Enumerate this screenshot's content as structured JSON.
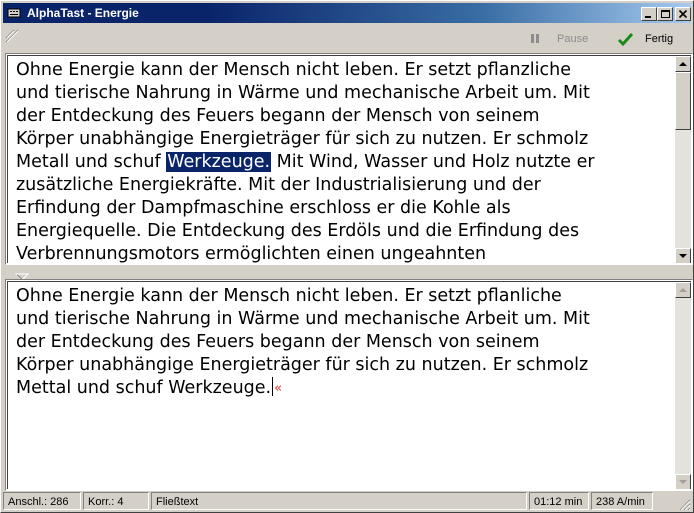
{
  "window": {
    "title": "AlphaTast - Energie"
  },
  "toolbar": {
    "pause_label": "Pause",
    "done_label": "Fertig"
  },
  "reference_text": {
    "lines": [
      {
        "parts": [
          "Ohne Energie kann der Mensch nicht leben. Er setzt pflanzliche"
        ]
      },
      {
        "parts": [
          "und tierische Nahrung in Wärme und mechanische Arbeit um. Mit"
        ]
      },
      {
        "parts": [
          "der Entdeckung des Feuers begann der Mensch von seinem"
        ]
      },
      {
        "parts": [
          "Körper unabhängige Energieträger für sich zu nutzen. Er schmolz"
        ]
      },
      {
        "parts": [
          "Metall und schuf ",
          "Werkzeuge.",
          " Mit Wind, Wasser und Holz nutzte er"
        ]
      },
      {
        "parts": [
          "zusätzliche Energiekräfte. Mit der Industrialisierung und der"
        ]
      },
      {
        "parts": [
          "Erfindung der Dampfmaschine erschloss er die Kohle als"
        ]
      },
      {
        "parts": [
          "Energiequelle. Die Entdeckung des Erdöls und die Erfindung des"
        ]
      },
      {
        "parts": [
          "Verbrennungsmotors ermöglichten einen ungeahnten"
        ]
      }
    ]
  },
  "typed_text": {
    "lines": [
      "Ohne Energie kann der Mensch nicht leben. Er setzt pflanliche",
      "und tierische Nahrung in Wärme und mechanische Arbeit um. Mit",
      "der Entdeckung des Feuers begann der Mensch von seinem",
      "Körper unabhängige Energieträger für sich zu nutzen. Er schmolz",
      "Mettal und schuf Werkzeuge."
    ],
    "error_marker": "«"
  },
  "statusbar": {
    "strokes": "Anschl.: 286",
    "corrections": "Korr.: 4",
    "mode": "Fließtext",
    "time": "01:12 min",
    "speed": "238 A/min"
  },
  "colors": {
    "titlebar": "#0a246a",
    "selection": "#0a246a",
    "error_marker": "#e03030",
    "done_check": "#1a8a1a"
  }
}
